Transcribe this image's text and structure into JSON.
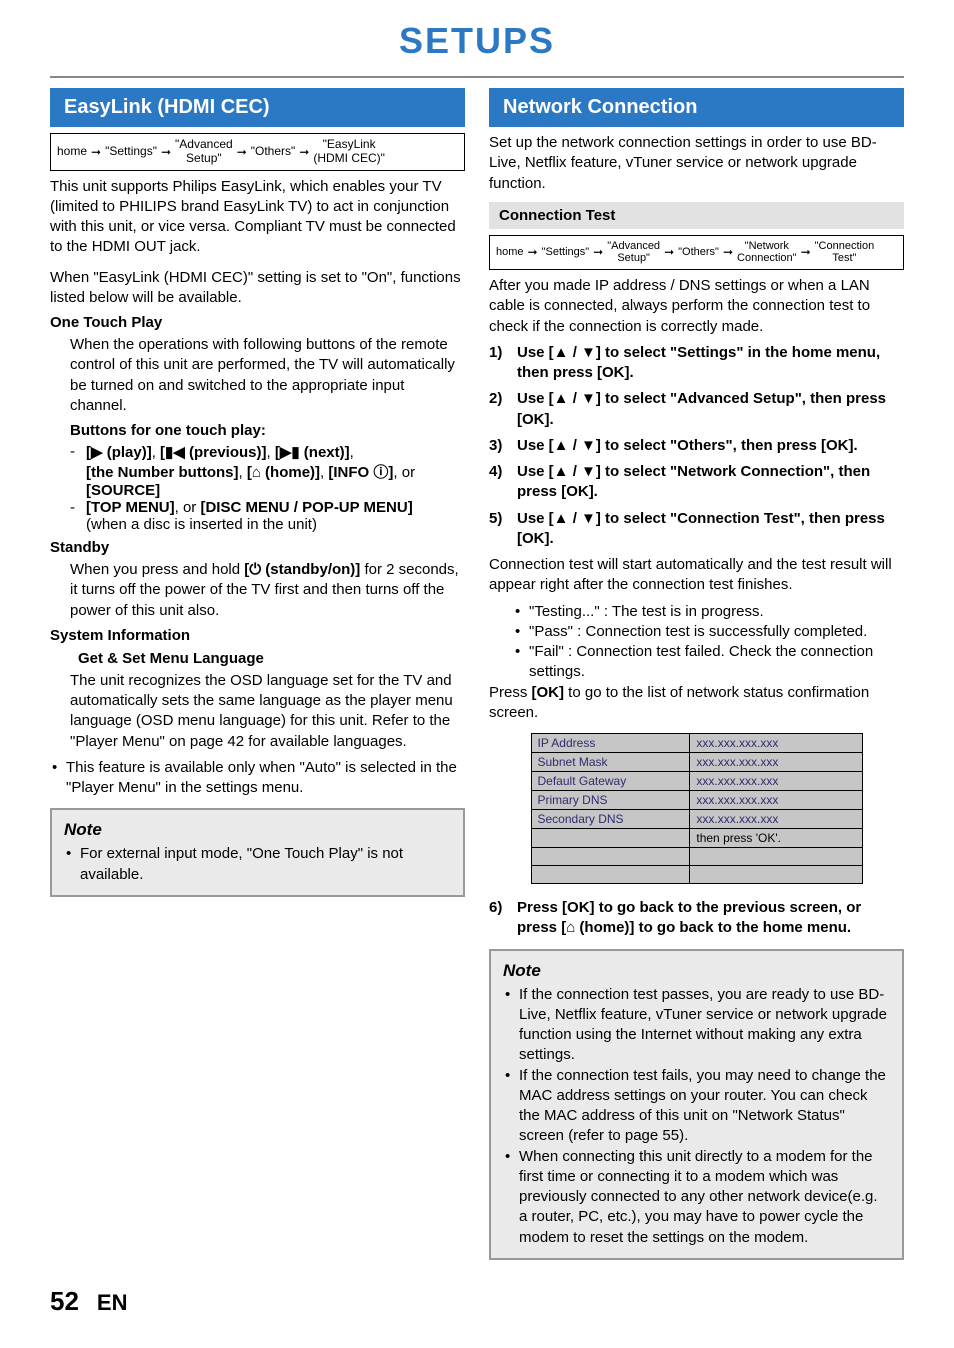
{
  "pageTitle": "SETUPS",
  "pageNumber": "52",
  "langCode": "EN",
  "left": {
    "heading": "EasyLink (HDMI CEC)",
    "nav": [
      "home",
      "\"Settings\"",
      "\"Advanced\nSetup\"",
      "\"Others\"",
      "\"EasyLink\n(HDMI CEC)\""
    ],
    "intro": "This unit supports Philips EasyLink, which enables your TV (limited to PHILIPS brand EasyLink TV) to act in conjunction with this unit, or vice versa. Compliant TV must be connected to the HDMI OUT jack.",
    "when": "When \"EasyLink (HDMI CEC)\" setting is set to \"On\", functions listed below will be available.",
    "oneTouchHead": "One Touch Play",
    "oneTouchBody": "When the operations with following buttons of the remote control of this unit are performed, the TV will automatically be turned on and switched to the appropriate input channel.",
    "buttonsFor": "Buttons for one touch play:",
    "btnLine1a": "[▶ (play)]",
    "btnLine1b": "[▮◀ (previous)]",
    "btnLine1c": "[▶▮ (next)]",
    "btnLine2a": "[the Number buttons]",
    "btnLine2b": "[⌂ (home)]",
    "btnLine2c": "[INFO ⓘ]",
    "btnLine2d": "[SOURCE]",
    "btnLine3a": "[TOP MENU]",
    "btnLine3b": "[DISC MENU / POP-UP MENU]",
    "btnLine3note": "(when a disc is inserted in the unit)",
    "standbyHead": "Standby",
    "standbyBody1": "When you press and hold ",
    "standbyButton": "[⏻ (standby/on)]",
    "standbyBody2": " for 2 seconds, it turns off the power of the TV first and then turns off the power of this unit also.",
    "sysInfoHead": "System Information",
    "getSetHead": "Get & Set Menu Language",
    "getSetBody": "The unit recognizes the OSD language set for the TV and automatically sets the same language as the player menu language (OSD menu language) for this unit. Refer to the \"Player Menu\" on page 42 for available languages.",
    "autoNote": "This feature is available only when \"Auto\" is selected in the \"Player Menu\" in the settings menu.",
    "noteTitle": "Note",
    "noteBody": "For external input mode, \"One Touch Play\" is not available."
  },
  "right": {
    "heading": "Network Connection",
    "intro": "Set up the network connection settings in order to use BD-Live, Netflix feature, vTuner service or network upgrade function.",
    "connTestHead": "Connection Test",
    "nav": [
      "home",
      "\"Settings\"",
      "\"Advanced\nSetup\"",
      "\"Others\"",
      "\"Network\nConnection\"",
      "\"Connection\nTest\""
    ],
    "afterIp": "After you made IP address / DNS settings or when a LAN cable is connected, always perform the connection test to check if the connection is correctly made.",
    "steps": [
      "Use [▲ / ▼] to select \"Settings\" in the home menu, then press [OK].",
      "Use [▲ / ▼] to select \"Advanced Setup\", then press [OK].",
      "Use [▲ / ▼] to select \"Others\", then press [OK].",
      "Use [▲ / ▼] to select \"Network Connection\", then press [OK].",
      "Use [▲ / ▼] to select \"Connection Test\", then press [OK]."
    ],
    "connStart": "Connection test will start automatically and the test result will appear right after the connection test finishes.",
    "results": [
      "\"Testing...\" : The test is in progress.",
      "\"Pass\" : Connection test is successfully completed.",
      "\"Fail\" : Connection test failed. Check the connection settings."
    ],
    "pressOk": "Press [OK] to go to the list of network status confirmation screen.",
    "table": [
      [
        "IP Address",
        "xxx.xxx.xxx.xxx"
      ],
      [
        "Subnet Mask",
        "xxx.xxx.xxx.xxx"
      ],
      [
        "Default Gateway",
        "xxx.xxx.xxx.xxx"
      ],
      [
        "Primary DNS",
        "xxx.xxx.xxx.xxx"
      ],
      [
        "Secondary DNS",
        "xxx.xxx.xxx.xxx"
      ],
      [
        "",
        "then press 'OK'."
      ],
      [
        "",
        ""
      ],
      [
        "",
        ""
      ]
    ],
    "step6": "Press [OK] to go back to the previous screen, or press [⌂ (home)] to go back to the home menu.",
    "noteTitle": "Note",
    "notes": [
      "If the connection test passes, you are ready to use BD-Live, Netflix feature, vTuner service or network upgrade function using the Internet without making any extra settings.",
      "If the connection test fails, you may need to change the MAC address settings on your router. You can check the MAC address of this unit on \"Network Status\" screen (refer to page 55).",
      "When connecting this unit directly to a modem for the first time or connecting it to a modem which was previously connected to any other network device(e.g. a router, PC, etc.), you may have to   power cycle the modem to reset the settings on the modem."
    ]
  }
}
